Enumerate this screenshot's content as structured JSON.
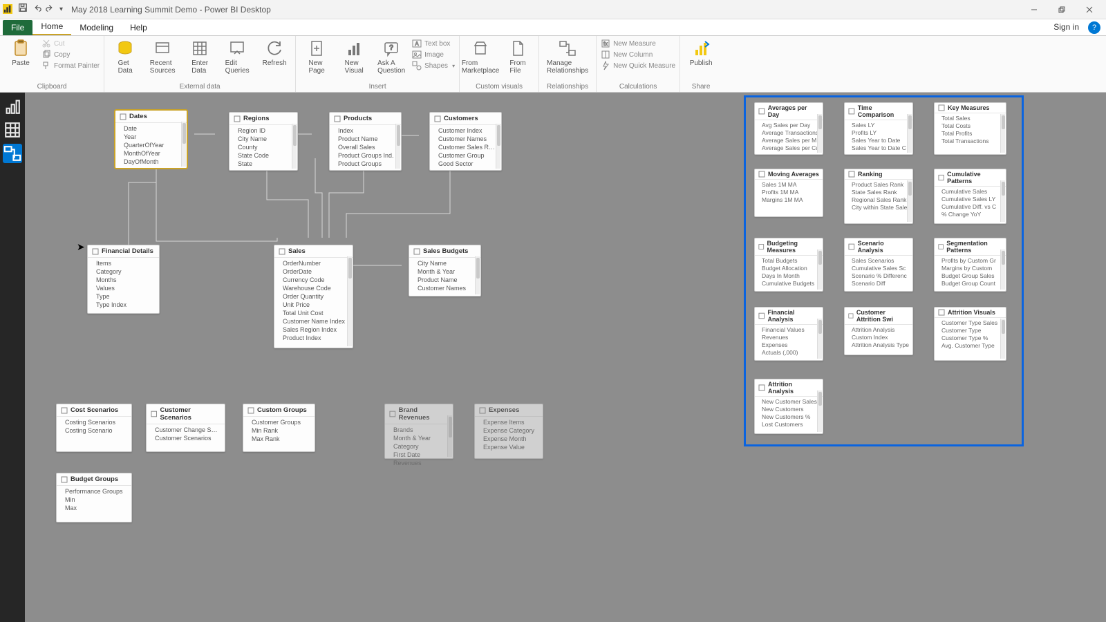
{
  "window": {
    "title": "May 2018 Learning Summit Demo - Power BI Desktop"
  },
  "quick_access": {
    "save": "save",
    "undo": "undo",
    "redo": "redo",
    "more": "more"
  },
  "win_controls": {
    "min": "minimize",
    "restore": "restore",
    "close": "close"
  },
  "menu": {
    "file": "File",
    "home": "Home",
    "modeling": "Modeling",
    "help": "Help",
    "signin": "Sign in"
  },
  "ribbon": {
    "clipboard": {
      "group_label": "Clipboard",
      "paste": "Paste",
      "cut": "Cut",
      "copy": "Copy",
      "format_painter": "Format Painter"
    },
    "external": {
      "group_label": "External data",
      "get_data": "Get\nData",
      "recent_sources": "Recent\nSources",
      "enter_data": "Enter\nData",
      "edit_queries": "Edit\nQueries",
      "refresh": "Refresh"
    },
    "insert": {
      "group_label": "Insert",
      "new_page": "New\nPage",
      "new_visual": "New\nVisual",
      "ask_question": "Ask A\nQuestion",
      "text_box": "Text box",
      "image": "Image",
      "shapes": "Shapes"
    },
    "custom_visuals": {
      "group_label": "Custom visuals",
      "from_marketplace": "From\nMarketplace",
      "from_file": "From\nFile"
    },
    "relationships": {
      "group_label": "Relationships",
      "manage": "Manage\nRelationships"
    },
    "calculations": {
      "group_label": "Calculations",
      "new_measure": "New Measure",
      "new_column": "New Column",
      "new_quick_measure": "New Quick Measure"
    },
    "share": {
      "group_label": "Share",
      "publish": "Publish"
    }
  },
  "rail": {
    "report": "report",
    "data": "data",
    "model": "model"
  },
  "tables": {
    "dates": {
      "title": "Dates",
      "cols": [
        "Date",
        "Year",
        "QuarterOfYear",
        "MonthOfYear",
        "DayOfMonth"
      ]
    },
    "regions": {
      "title": "Regions",
      "cols": [
        "Region ID",
        "City Name",
        "County",
        "State Code",
        "State"
      ]
    },
    "products": {
      "title": "Products",
      "cols": [
        "Index",
        "Product Name",
        "Overall Sales",
        "Product Groups Ind.",
        "Product Groups"
      ]
    },
    "customers": {
      "title": "Customers",
      "cols": [
        "Customer Index",
        "Customer Names",
        "Customer Sales Rank",
        "Customer Group",
        "Good Sector"
      ]
    },
    "financial_details": {
      "title": "Financial Details",
      "cols": [
        "Items",
        "Category",
        "Months",
        "Values",
        "Type",
        "Type Index"
      ]
    },
    "sales": {
      "title": "Sales",
      "cols": [
        "OrderNumber",
        "OrderDate",
        "Currency Code",
        "Warehouse Code",
        "Order Quantity",
        "Unit Price",
        "Total Unit Cost",
        "Customer Name Index",
        "Sales Region Index",
        "Product Index"
      ]
    },
    "sales_budgets": {
      "title": "Sales Budgets",
      "cols": [
        "City Name",
        "Month & Year",
        "Product Name",
        "Customer Names"
      ]
    },
    "cost_scenarios": {
      "title": "Cost Scenarios",
      "cols": [
        "Costing Scenarios",
        "Costing Scenario"
      ]
    },
    "customer_scenarios": {
      "title": "Customer Scenarios",
      "cols": [
        "Customer Change Scen.",
        "Customer Scenarios"
      ]
    },
    "custom_groups": {
      "title": "Custom Groups",
      "cols": [
        "Customer Groups",
        "Min Rank",
        "Max Rank"
      ]
    },
    "brand_revenues": {
      "title": "Brand Revenues",
      "cols": [
        "Brands",
        "Month & Year",
        "Category",
        "First Date",
        "Revenues"
      ]
    },
    "expenses": {
      "title": "Expenses",
      "cols": [
        "Expense Items",
        "Expense Category",
        "Expense Month",
        "Expense Value"
      ]
    },
    "budget_groups": {
      "title": "Budget Groups",
      "cols": [
        "Performance Groups",
        "Min",
        "Max"
      ]
    }
  },
  "measure_cards": {
    "avg_per_day": {
      "title": "Averages per Day",
      "items": [
        "Avg Sales per Day",
        "Average Transactions",
        "Average Sales per M",
        "Average Sales per Cu"
      ]
    },
    "time_comparison": {
      "title": "Time Comparison",
      "items": [
        "Sales LY",
        "Profits LY",
        "Sales Year to Date",
        "Sales Year to Date C"
      ]
    },
    "key_measures": {
      "title": "Key Measures",
      "items": [
        "Total Sales",
        "Total Costs",
        "Total Profits",
        "Total Transactions"
      ]
    },
    "moving_avg": {
      "title": "Moving Averages",
      "items": [
        "Sales 1M MA",
        "Profits 1M MA",
        "Margins 1M MA"
      ]
    },
    "ranking": {
      "title": "Ranking",
      "items": [
        "Product Sales Rank",
        "State Sales Rank",
        "Regional Sales Rank",
        "City within State Sale"
      ]
    },
    "cumulative": {
      "title": "Cumulative Patterns",
      "items": [
        "Cumulative Sales",
        "Cumulative Sales LY",
        "Cumulative Diff. vs C",
        "% Change YoY"
      ]
    },
    "budgeting": {
      "title": "Budgeting Measures",
      "items": [
        "Total Budgets",
        "Budget Allocation",
        "Days In Month",
        "Cumulative Budgets"
      ]
    },
    "scenario": {
      "title": "Scenario Analysis",
      "items": [
        "Sales Scenarios",
        "Cumulative Sales Sc",
        "Scenario % Differenc",
        "Scenario Diff"
      ]
    },
    "segmentation": {
      "title": "Segmentation Patterns",
      "items": [
        "Profits by Custom Gr",
        "Margins by Custom",
        "Budget Group Sales",
        "Budget Group Count"
      ]
    },
    "financial_analysis": {
      "title": "Financial Analysis",
      "items": [
        "Financial Values",
        "Revenues",
        "Expenses",
        "Actuals (,000)"
      ]
    },
    "customer_attrition": {
      "title": "Customer Attrition Swi",
      "items": [
        "Attrition Analysis",
        "Custom Index",
        "Attrition Analysis Type"
      ]
    },
    "attrition_visuals": {
      "title": "Attrition Visuals",
      "items": [
        "Customer Type Sales",
        "Customer Type",
        "Customer Type %",
        "Avg. Customer Type"
      ]
    },
    "attrition_analysis": {
      "title": "Attrition Analysis",
      "items": [
        "New Customer Sales",
        "New Customers",
        "New Customers %",
        "Lost Customers"
      ]
    }
  }
}
